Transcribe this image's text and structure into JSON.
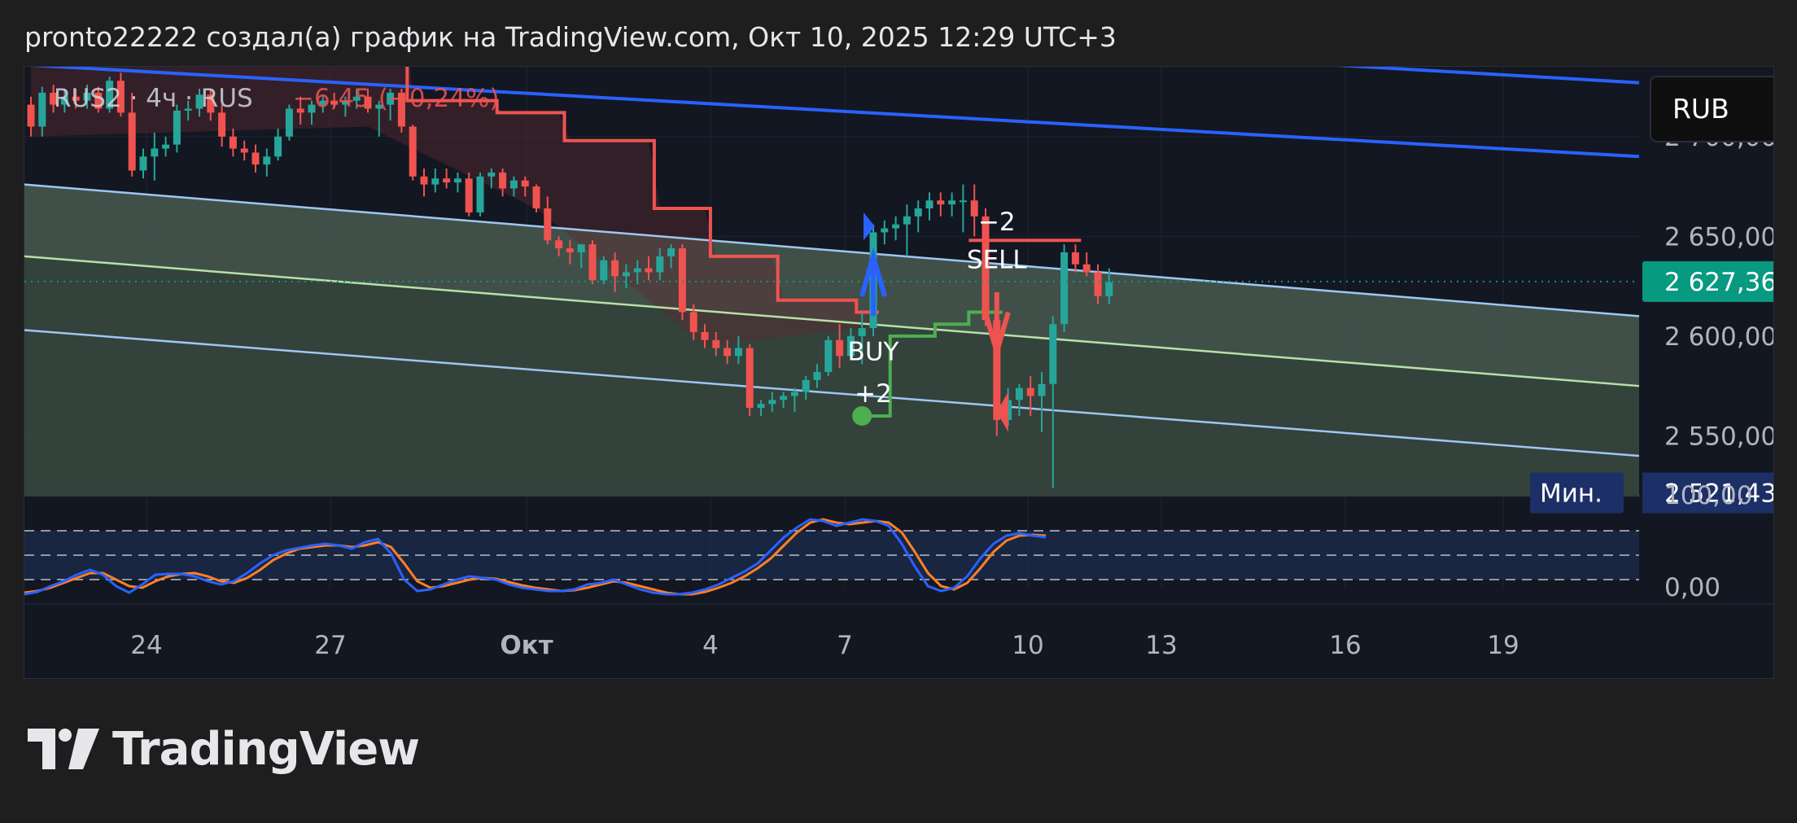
{
  "header": {
    "title": "pronto22222 создал(а) график на TradingView.com, Окт 10, 2025 12:29 UTC+3"
  },
  "logo": {
    "text": "TradingView"
  },
  "colors": {
    "background": "#131722",
    "up_candle": "#26a69a",
    "down_candle": "#ef5350",
    "supertrend_down": "#ef5350",
    "supertrend_up": "#4caf50",
    "channel_dark": "#2962ff",
    "channel_light": "#9fc7f0",
    "midline": "#b8e0a8",
    "stoch_k": "#2962ff",
    "stoch_d": "#ff7f27",
    "price_badge": "#089981",
    "min_badge": "#1c2f66"
  },
  "chart_data": {
    "type": "candlestick",
    "symbol": {
      "name": "RUS2 · 4ч · RUS",
      "change": "−6,45 (−0,24%)"
    },
    "currency_button": "RUB",
    "price_axis": {
      "ticks": [
        "2 700,00",
        "2 650,00",
        "2 600,00",
        "2 550,00"
      ],
      "current_price": "2 627,36",
      "min_label": "Мин.",
      "min_value": "2 521,43"
    },
    "oscillator_axis": {
      "ticks": [
        "100,00",
        "0,00"
      ],
      "bands": [
        80,
        50,
        20
      ]
    },
    "time_axis": [
      "24",
      "27",
      "Окт",
      "4",
      "7",
      "10",
      "13",
      "16",
      "19"
    ],
    "ylim": [
      2520,
      2735
    ],
    "signals": [
      {
        "label": "BUY",
        "qty": "+2",
        "direction": "up"
      },
      {
        "label": "SELL",
        "qty": "−2",
        "direction": "down"
      }
    ],
    "candles": [
      [
        2716,
        2720,
        2700,
        2705
      ],
      [
        2705,
        2725,
        2700,
        2722
      ],
      [
        2722,
        2726,
        2712,
        2716
      ],
      [
        2716,
        2724,
        2712,
        2720
      ],
      [
        2720,
        2724,
        2714,
        2718
      ],
      [
        2718,
        2726,
        2714,
        2722
      ],
      [
        2722,
        2725,
        2712,
        2714
      ],
      [
        2714,
        2730,
        2712,
        2728
      ],
      [
        2728,
        2732,
        2710,
        2712
      ],
      [
        2712,
        2722,
        2680,
        2683
      ],
      [
        2683,
        2694,
        2679,
        2690
      ],
      [
        2690,
        2702,
        2678,
        2694
      ],
      [
        2694,
        2700,
        2690,
        2696
      ],
      [
        2696,
        2716,
        2692,
        2713
      ],
      [
        2713,
        2718,
        2708,
        2714
      ],
      [
        2714,
        2724,
        2710,
        2721
      ],
      [
        2721,
        2724,
        2708,
        2712
      ],
      [
        2712,
        2716,
        2695,
        2700
      ],
      [
        2700,
        2704,
        2690,
        2694
      ],
      [
        2694,
        2698,
        2688,
        2692
      ],
      [
        2692,
        2696,
        2682,
        2686
      ],
      [
        2686,
        2694,
        2680,
        2690
      ],
      [
        2690,
        2704,
        2688,
        2700
      ],
      [
        2700,
        2716,
        2698,
        2714
      ],
      [
        2714,
        2720,
        2706,
        2712
      ],
      [
        2712,
        2718,
        2706,
        2716
      ],
      [
        2716,
        2720,
        2712,
        2718
      ],
      [
        2718,
        2722,
        2714,
        2716
      ],
      [
        2716,
        2720,
        2710,
        2718
      ],
      [
        2718,
        2724,
        2714,
        2720
      ],
      [
        2720,
        2724,
        2712,
        2714
      ],
      [
        2714,
        2718,
        2700,
        2716
      ],
      [
        2716,
        2724,
        2708,
        2722
      ],
      [
        2722,
        2724,
        2702,
        2705
      ],
      [
        2705,
        2706,
        2678,
        2680
      ],
      [
        2680,
        2684,
        2670,
        2676
      ],
      [
        2676,
        2684,
        2672,
        2679
      ],
      [
        2679,
        2684,
        2674,
        2677
      ],
      [
        2677,
        2682,
        2672,
        2679
      ],
      [
        2679,
        2682,
        2660,
        2662
      ],
      [
        2662,
        2682,
        2660,
        2680
      ],
      [
        2680,
        2684,
        2674,
        2682
      ],
      [
        2682,
        2684,
        2670,
        2674
      ],
      [
        2674,
        2680,
        2670,
        2678
      ],
      [
        2678,
        2680,
        2670,
        2675
      ],
      [
        2675,
        2676,
        2662,
        2664
      ],
      [
        2664,
        2670,
        2646,
        2648
      ],
      [
        2648,
        2650,
        2640,
        2644
      ],
      [
        2644,
        2648,
        2636,
        2642
      ],
      [
        2642,
        2646,
        2634,
        2646
      ],
      [
        2646,
        2648,
        2626,
        2628
      ],
      [
        2628,
        2640,
        2626,
        2638
      ],
      [
        2638,
        2642,
        2622,
        2630
      ],
      [
        2630,
        2636,
        2624,
        2632
      ],
      [
        2632,
        2638,
        2626,
        2634
      ],
      [
        2634,
        2640,
        2628,
        2632
      ],
      [
        2632,
        2644,
        2628,
        2640
      ],
      [
        2640,
        2646,
        2634,
        2644
      ],
      [
        2644,
        2646,
        2608,
        2612
      ],
      [
        2612,
        2616,
        2598,
        2602
      ],
      [
        2602,
        2606,
        2594,
        2598
      ],
      [
        2598,
        2602,
        2590,
        2594
      ],
      [
        2594,
        2598,
        2586,
        2590
      ],
      [
        2590,
        2600,
        2586,
        2594
      ],
      [
        2594,
        2596,
        2560,
        2564
      ],
      [
        2564,
        2568,
        2560,
        2566
      ],
      [
        2566,
        2572,
        2562,
        2568
      ],
      [
        2568,
        2572,
        2564,
        2570
      ],
      [
        2570,
        2574,
        2562,
        2572
      ],
      [
        2572,
        2580,
        2568,
        2578
      ],
      [
        2578,
        2586,
        2574,
        2582
      ],
      [
        2582,
        2600,
        2580,
        2598
      ],
      [
        2598,
        2606,
        2584,
        2590
      ],
      [
        2590,
        2604,
        2588,
        2600
      ],
      [
        2600,
        2612,
        2586,
        2604
      ],
      [
        2604,
        2656,
        2600,
        2652
      ],
      [
        2652,
        2658,
        2646,
        2654
      ],
      [
        2654,
        2660,
        2648,
        2656
      ],
      [
        2656,
        2666,
        2640,
        2660
      ],
      [
        2660,
        2668,
        2652,
        2664
      ],
      [
        2664,
        2672,
        2658,
        2668
      ],
      [
        2668,
        2672,
        2660,
        2666
      ],
      [
        2666,
        2672,
        2660,
        2668
      ],
      [
        2668,
        2676,
        2652,
        2668
      ],
      [
        2668,
        2676,
        2650,
        2660
      ],
      [
        2660,
        2664,
        2605,
        2608
      ],
      [
        2608,
        2612,
        2550,
        2558
      ],
      [
        2558,
        2574,
        2555,
        2568
      ],
      [
        2568,
        2576,
        2560,
        2574
      ],
      [
        2574,
        2580,
        2560,
        2570
      ],
      [
        2570,
        2582,
        2552,
        2576
      ],
      [
        2576,
        2610,
        2524,
        2606
      ],
      [
        2606,
        2646,
        2602,
        2642
      ],
      [
        2642,
        2646,
        2632,
        2636
      ],
      [
        2636,
        2642,
        2630,
        2632
      ],
      [
        2632,
        2636,
        2616,
        2620
      ],
      [
        2620,
        2634,
        2616,
        2627
      ]
    ],
    "supertrend": [
      {
        "from": 0,
        "to": 2,
        "value": 2760
      },
      {
        "from": 3,
        "to": 6,
        "value": 2780
      },
      {
        "from": 7,
        "to": 11,
        "value": 2790
      },
      {
        "from": 12,
        "to": 22,
        "value": 2792
      },
      {
        "from": 23,
        "to": 33,
        "value": 2794
      },
      {
        "from": 34,
        "to": 41,
        "value": 2718
      },
      {
        "from": 42,
        "to": 47,
        "value": 2712
      },
      {
        "from": 48,
        "to": 55,
        "value": 2698
      },
      {
        "from": 56,
        "to": 60,
        "value": 2664
      },
      {
        "from": 61,
        "to": 66,
        "value": 2640
      },
      {
        "from": 67,
        "to": 73,
        "value": 2618
      },
      {
        "from": 74,
        "to": 75,
        "value": 2612
      }
    ],
    "supertrend_up": [
      {
        "from": 74,
        "to": 76,
        "value": 2560
      },
      {
        "from": 77,
        "to": 80,
        "value": 2600
      },
      {
        "from": 81,
        "to": 83,
        "value": 2606
      },
      {
        "from": 84,
        "to": 86,
        "value": 2612
      }
    ],
    "supertrend_down2": [
      {
        "from": 84,
        "to": 93,
        "value": 2648
      }
    ],
    "channel": {
      "dark_upper": [
        2736,
        2690
      ],
      "dark_mid": [
        2774,
        2727
      ],
      "dark_top": [
        2778,
        2760
      ],
      "light_upper": [
        2676,
        2610
      ],
      "midline": [
        2640,
        2575
      ],
      "light_lower": [
        2603,
        2540
      ]
    },
    "stochastic": {
      "k": [
        2,
        5,
        12,
        18,
        26,
        32,
        26,
        12,
        4,
        14,
        26,
        27,
        27,
        24,
        18,
        14,
        18,
        28,
        40,
        50,
        56,
        59,
        62,
        64,
        62,
        58,
        66,
        70,
        52,
        20,
        6,
        8,
        14,
        20,
        24,
        22,
        20,
        14,
        10,
        8,
        6,
        6,
        8,
        14,
        16,
        20,
        14,
        8,
        4,
        2,
        2,
        4,
        8,
        14,
        22,
        30,
        40,
        56,
        72,
        84,
        94,
        92,
        86,
        90,
        94,
        92,
        86,
        64,
        36,
        12,
        6,
        10,
        24,
        46,
        64,
        74,
        77,
        74,
        72
      ],
      "d": [
        4,
        6,
        10,
        16,
        22,
        28,
        28,
        20,
        12,
        10,
        18,
        24,
        27,
        28,
        24,
        18,
        16,
        22,
        32,
        44,
        52,
        58,
        60,
        62,
        62,
        60,
        62,
        66,
        60,
        40,
        18,
        10,
        12,
        16,
        20,
        22,
        21,
        17,
        13,
        10,
        8,
        6,
        7,
        10,
        14,
        18,
        16,
        12,
        8,
        4,
        2,
        2,
        5,
        10,
        16,
        24,
        34,
        46,
        62,
        78,
        90,
        94,
        90,
        88,
        90,
        92,
        90,
        78,
        54,
        28,
        12,
        8,
        16,
        34,
        54,
        68,
        74,
        75,
        74
      ]
    }
  }
}
